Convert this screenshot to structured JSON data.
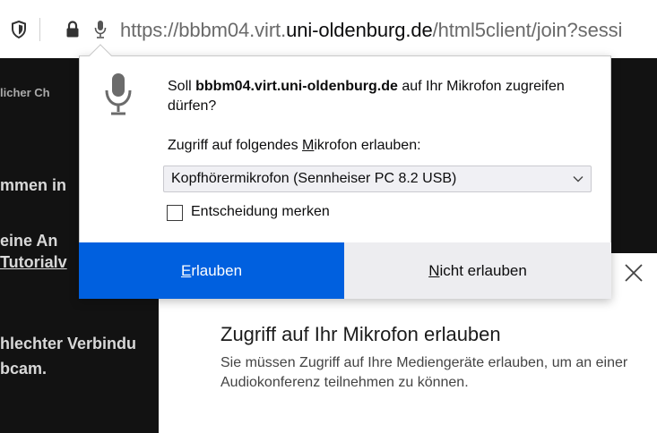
{
  "urlbar": {
    "url_prefix": "https://bbbm04.virt.",
    "url_domain": "uni-oldenburg.de",
    "url_suffix": "/html5client/join?sessi"
  },
  "background": {
    "line1": "licher Ch",
    "line2": "mmen in",
    "line3": "eine An",
    "line4": "Tutorialv",
    "line5": "hlechter Verbindu",
    "line6": "bcam."
  },
  "doorhanger": {
    "question_prefix": "Soll ",
    "question_host": "bbbm04.virt.uni-oldenburg.de",
    "question_suffix": " auf Ihr Mikrofon zugreifen dürfen?",
    "label_before": "Zugriff auf folgendes ",
    "label_accel": "M",
    "label_after": "ikrofon erlauben:",
    "selected_device": "Kopfhörermikrofon (Sennheiser PC 8.2 USB)",
    "remember_label": "Entscheidung merken",
    "allow_accel": "E",
    "allow_rest": "rlauben",
    "deny_accel": "N",
    "deny_rest": "icht erlauben"
  },
  "modal": {
    "title": "Zugriff auf Ihr Mikrofon erlauben",
    "text": "Sie müssen Zugriff auf Ihre Mediengeräte erlauben, um an einer Audiokonferenz teilnehmen zu können."
  },
  "colors": {
    "allow_button": "#0060df",
    "deny_button": "#ededf0",
    "page_background": "#121212"
  }
}
